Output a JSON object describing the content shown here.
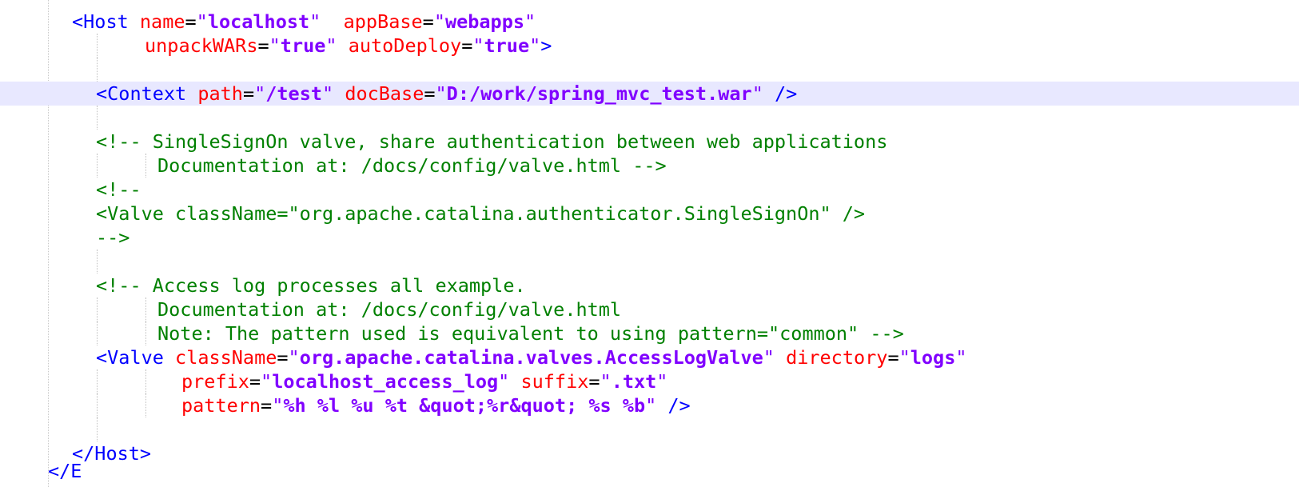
{
  "editor": {
    "colors": {
      "tag": "#0000ff",
      "attribute": "#ff0000",
      "value": "#8000ff",
      "comment": "#008000",
      "current_line": "#e8e8ff"
    },
    "lines": {
      "l1": {
        "open": "<Host",
        "a1": "name",
        "v1": "localhost",
        "a2": "appBase",
        "v2": "webapps"
      },
      "l2": {
        "a1": "unpackWARs",
        "v1": "true",
        "a2": "autoDeploy",
        "v2": "true",
        "close": ">"
      },
      "l3": {
        "open": "<Context",
        "a1": "path",
        "v1": "/test",
        "a2": "docBase",
        "v2": "D:/work/spring_mvc_test.war",
        "close": " />"
      },
      "l4": {
        "text": "<!-- SingleSignOn valve, share authentication between web applications"
      },
      "l5": {
        "text": "Documentation at: /docs/config/valve.html -->"
      },
      "l6": {
        "text": "<!--"
      },
      "l7": {
        "text": "<Valve className=\"org.apache.catalina.authenticator.SingleSignOn\" />"
      },
      "l8": {
        "text": "-->"
      },
      "l9": {
        "text": "<!-- Access log processes all example."
      },
      "l10": {
        "text": "Documentation at: /docs/config/valve.html"
      },
      "l11": {
        "text": "Note: The pattern used is equivalent to using pattern=\"common\" -->"
      },
      "l12": {
        "open": "<Valve",
        "a1": "className",
        "v1": "org.apache.catalina.valves.AccessLogValve",
        "a2": "directory",
        "v2": "logs"
      },
      "l13": {
        "a1": "prefix",
        "v1": "localhost_access_log",
        "a2": "suffix",
        "v2": ".txt"
      },
      "l14": {
        "a1": "pattern",
        "v1": "%h %l %u %t &quot;%r&quot; %s %b",
        "close": " />"
      },
      "l15": {
        "text": "</Host>"
      }
    }
  }
}
